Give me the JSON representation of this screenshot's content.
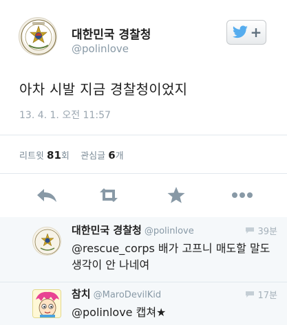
{
  "account": {
    "display_name": "대한민국 경찰청",
    "handle": "@polinlove",
    "follow_button_label": "+"
  },
  "tweet": {
    "text": "아차 시발 지금 경찰청이었지",
    "timestamp": "13. 4. 1. 오전 11:57"
  },
  "stats": {
    "retweets_label": "리트윗",
    "retweets_count": "81",
    "retweets_unit": "회",
    "favorites_label": "관심글",
    "favorites_count": "6",
    "favorites_unit": "개"
  },
  "actions": [
    "reply-icon",
    "retweet-icon",
    "star-icon",
    "more-icon"
  ],
  "replies": [
    {
      "display_name": "대한민국 경찰청",
      "handle": "@polinlove",
      "time": "39분",
      "text": "@rescue_corps 배가 고프니 매도할 말도 생각이 안 나네여"
    },
    {
      "display_name": "참치",
      "handle": "@MaroDevilKid",
      "time": "17분",
      "text": "@polinlove 캡쳐★"
    }
  ],
  "colors": {
    "twitter_blue": "#55acee",
    "icon_gray": "#8899a6",
    "replies_bg": "#f5f8fa"
  }
}
